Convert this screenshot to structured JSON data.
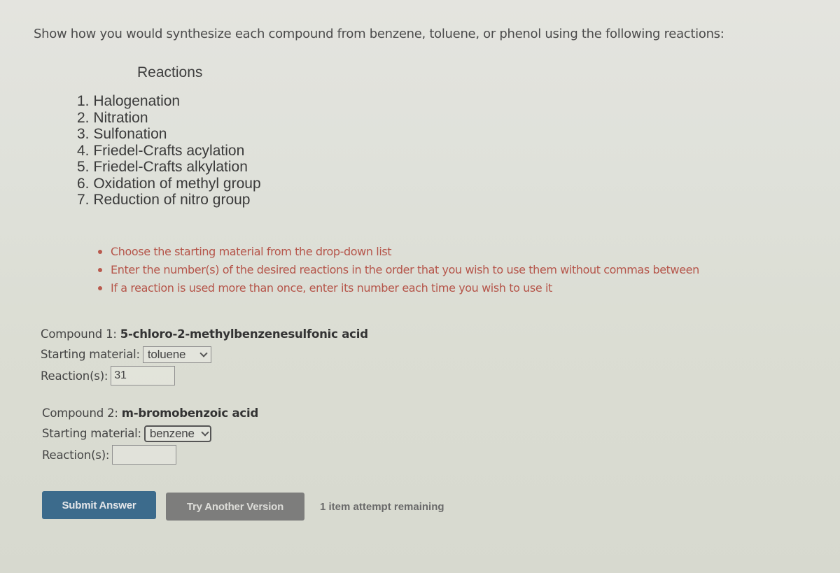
{
  "question": {
    "prompt": "Show how you would synthesize each compound from benzene, toluene, or phenol using the following reactions:"
  },
  "reactions": {
    "title": "Reactions",
    "items": [
      "1. Halogenation",
      "2. Nitration",
      "3. Sulfonation",
      "4. Friedel-Crafts acylation",
      "5. Friedel-Crafts alkylation",
      "6. Oxidation of methyl group",
      "7. Reduction of nitro group"
    ]
  },
  "instructions": [
    "Choose the starting material from the drop-down list",
    "Enter the number(s) of the desired reactions in the order that you wish to use them without commas between",
    "If a reaction is used more than once, enter its number each time you wish to use it"
  ],
  "compounds": [
    {
      "label": "Compound 1:",
      "name": "5-chloro-2-methylbenzenesulfonic acid",
      "starting_label": "Starting material:",
      "starting_value": "toluene",
      "reactions_label": "Reaction(s):",
      "reactions_value": "31"
    },
    {
      "label": "Compound 2:",
      "name": "m-bromobenzoic acid",
      "starting_label": "Starting material:",
      "starting_value": "benzene",
      "reactions_label": "Reaction(s):",
      "reactions_value": ""
    }
  ],
  "actions": {
    "submit_label": "Submit Answer",
    "try_another_label": "Try Another Version",
    "attempts_text": "1 item attempt remaining"
  },
  "colors": {
    "submit_bg": "#3c6b8c",
    "try_another_bg": "#7d7d7c",
    "instruction_text": "#b5554a"
  }
}
